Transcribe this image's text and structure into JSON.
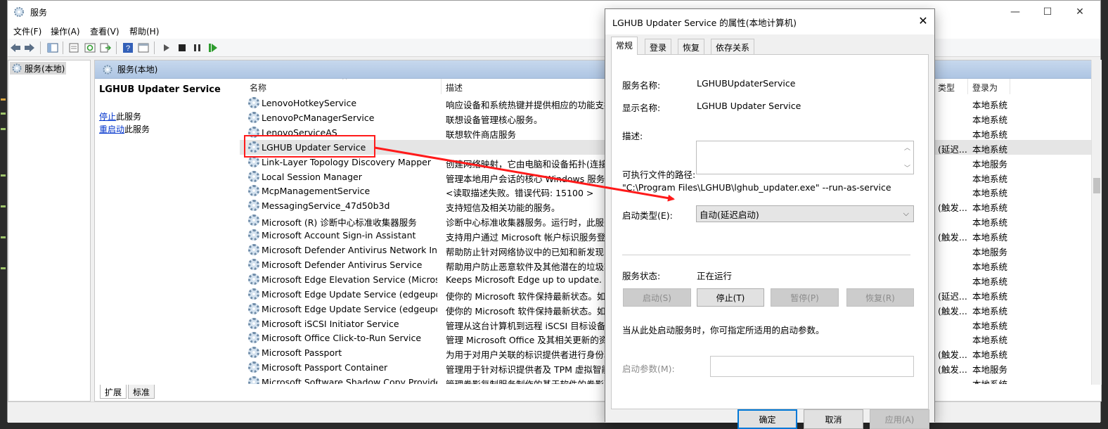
{
  "window": {
    "title": "服务",
    "minimize_icon": "—",
    "maximize_icon": "☐",
    "close_icon": "✕"
  },
  "menu": [
    "文件(F)",
    "操作(A)",
    "查看(V)",
    "帮助(H)"
  ],
  "toolbar_icons": [
    "back-icon",
    "forward-icon",
    "show-hide-tree-icon",
    "properties-icon",
    "refresh-icon",
    "export-icon",
    "help-icon",
    "console-icon",
    "start-icon",
    "stop-icon",
    "pause-icon",
    "restart-icon"
  ],
  "tree": {
    "item": "服务(本地)"
  },
  "content": {
    "header": "服务(本地)",
    "selected_service_title": "LGHUB Updater Service",
    "stop_link": "停止",
    "stop_suffix": "此服务",
    "restart_link": "重启动",
    "restart_suffix": "此服务",
    "columns": {
      "name": "名称",
      "desc": "描述",
      "type": "类型",
      "logon": "登录为"
    },
    "rows": [
      {
        "name": "LenovoHotkeyService",
        "desc": "响应设备和系统热键并提供相应的功能支持。",
        "type": "",
        "logon": "本地系统"
      },
      {
        "name": "LenovoPcManagerService",
        "desc": "联想设备管理核心服务。",
        "type": "",
        "logon": "本地系统"
      },
      {
        "name": "LenovoServiceAS",
        "desc": "联想软件商店服务",
        "type": "",
        "logon": "本地系统"
      },
      {
        "name": "LGHUB Updater Service",
        "desc": "",
        "type": "(延迟...",
        "logon": "本地系统"
      },
      {
        "name": "Link-Layer Topology Discovery Mapper",
        "desc": "创建网络映射，它由电脑和设备拓扑(连接)信",
        "type": "",
        "logon": "本地服务"
      },
      {
        "name": "Local Session Manager",
        "desc": "管理本地用户会话的核心 Windows 服务。停",
        "type": "",
        "logon": "本地系统"
      },
      {
        "name": "McpManagementService",
        "desc": "<读取描述失败。错误代码: 15100 >",
        "type": "",
        "logon": "本地系统"
      },
      {
        "name": "MessagingService_47d50b3d",
        "desc": "支持短信及相关功能的服务。",
        "type": "(触发...",
        "logon": "本地系统"
      },
      {
        "name": "Microsoft (R) 诊断中心标准收集器服务",
        "desc": "诊断中心标准收集器服务。运行时，此服务会",
        "type": "",
        "logon": "本地系统"
      },
      {
        "name": "Microsoft Account Sign-in Assistant",
        "desc": "支持用户通过 Microsoft 帐户标识服务登录",
        "type": "(触发...",
        "logon": "本地系统"
      },
      {
        "name": "Microsoft Defender Antivirus Network Ins...",
        "desc": "帮助防止针对网络协议中的已知和新发现的漏",
        "type": "",
        "logon": "本地服务"
      },
      {
        "name": "Microsoft Defender Antivirus Service",
        "desc": "帮助用户防止恶意软件及其他潜在的垃圾软件",
        "type": "",
        "logon": "本地系统"
      },
      {
        "name": "Microsoft Edge Elevation Service (Microso...",
        "desc": "Keeps Microsoft Edge up to update. If t",
        "type": "",
        "logon": "本地系统"
      },
      {
        "name": "Microsoft Edge Update Service (edgeupd...",
        "desc": "使你的 Microsoft 软件保持最新状态。如果",
        "type": "(延迟...",
        "logon": "本地系统"
      },
      {
        "name": "Microsoft Edge Update Service (edgeupd...",
        "desc": "使你的 Microsoft 软件保持最新状态。如果",
        "type": "(触发...",
        "logon": "本地系统"
      },
      {
        "name": "Microsoft iSCSI Initiator Service",
        "desc": "管理从这台计算机到远程 iSCSI 目标设备的",
        "type": "",
        "logon": "本地系统"
      },
      {
        "name": "Microsoft Office Click-to-Run Service",
        "desc": "管理 Microsoft Office 及其相关更新的资源",
        "type": "",
        "logon": "本地系统"
      },
      {
        "name": "Microsoft Passport",
        "desc": "为用于对用户关联的标识提供者进行身份验证",
        "type": "(触发...",
        "logon": "本地系统"
      },
      {
        "name": "Microsoft Passport Container",
        "desc": "管理用于针对标识提供者及 TPM 虚拟智能卡",
        "type": "(触发...",
        "logon": "本地服务"
      },
      {
        "name": "Microsoft Software Shadow Copy Provider",
        "desc": "管理卷影复制服务制作的基于软件的卷影副本",
        "type": "",
        "logon": "本地系统"
      }
    ],
    "bottom_tabs": [
      "扩展",
      "标准"
    ]
  },
  "dialog": {
    "title": "LGHUB Updater Service 的属性(本地计算机)",
    "close_icon": "✕",
    "tabs": [
      "常规",
      "登录",
      "恢复",
      "依存关系"
    ],
    "service_name_label": "服务名称:",
    "service_name": "LGHUBUpdaterService",
    "display_name_label": "显示名称:",
    "display_name": "LGHUB Updater Service",
    "description_label": "描述:",
    "path_label": "可执行文件的路径:",
    "path": "\"C:\\Program Files\\LGHUB\\lghub_updater.exe\" --run-as-service",
    "startup_type_label": "启动类型(E):",
    "startup_type": "自动(延迟启动)",
    "status_label": "服务状态:",
    "status": "正在运行",
    "btn_start": "启动(S)",
    "btn_stop": "停止(T)",
    "btn_pause": "暂停(P)",
    "btn_resume": "恢复(R)",
    "hint": "当从此处启动服务时，你可指定所适用的启动参数。",
    "params_label": "启动参数(M):",
    "ok": "确定",
    "cancel": "取消",
    "apply": "应用(A)"
  },
  "annotation": {
    "highlight_color": "#ff1a1a",
    "accent": "#0078d7"
  }
}
